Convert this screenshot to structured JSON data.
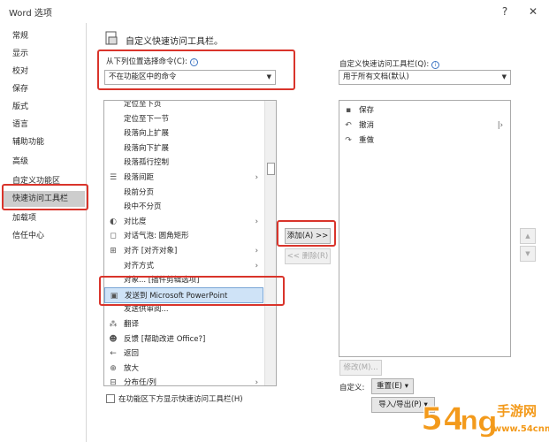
{
  "window": {
    "title": "Word 选项",
    "help": "?",
    "close": "✕"
  },
  "sidebar": {
    "items": [
      {
        "label": "常规"
      },
      {
        "label": "显示"
      },
      {
        "label": "校对"
      },
      {
        "label": "保存"
      },
      {
        "label": "版式"
      },
      {
        "label": "语言"
      },
      {
        "label": "辅助功能"
      },
      {
        "label": "高级"
      },
      {
        "label": "自定义功能区"
      },
      {
        "label": "快速访问工具栏"
      },
      {
        "label": "加载项"
      },
      {
        "label": "信任中心"
      }
    ],
    "active_index": 9
  },
  "header": {
    "title": "自定义快速访问工具栏。"
  },
  "choose_commands": {
    "label": "从下列位置选择命令(C):",
    "info_icon": "info-icon",
    "value": "不在功能区中的命令"
  },
  "customize_qat": {
    "label": "自定义快速访问工具栏(Q):",
    "info_icon": "info-icon",
    "value": "用于所有文档(默认)"
  },
  "commands": [
    {
      "label": "定位至下页",
      "icon": ""
    },
    {
      "label": "定位至下一节",
      "icon": ""
    },
    {
      "label": "段落向上扩展",
      "icon": ""
    },
    {
      "label": "段落向下扩展",
      "icon": ""
    },
    {
      "label": "段落孤行控制",
      "icon": ""
    },
    {
      "label": "段落间距",
      "icon": "paragraph-spacing-icon",
      "sub": "›"
    },
    {
      "label": "段前分页",
      "icon": ""
    },
    {
      "label": "段中不分页",
      "icon": ""
    },
    {
      "label": "对比度",
      "icon": "contrast-icon",
      "sub": "›"
    },
    {
      "label": "对话气泡: 圆角矩形",
      "icon": "speech-bubble-icon"
    },
    {
      "label": "对齐 [对齐对象]",
      "icon": "align-icon",
      "sub": "›"
    },
    {
      "label": "对齐方式",
      "icon": "",
      "sub": "›"
    },
    {
      "label": "对象... [插件剪辑选项]",
      "icon": ""
    },
    {
      "label": "发送到 Microsoft PowerPoint",
      "icon": "powerpoint-icon",
      "selected": true
    },
    {
      "label": "发送供审阅...",
      "icon": ""
    },
    {
      "label": "翻译",
      "icon": "translate-icon"
    },
    {
      "label": "反馈 [帮助改进 Office?]",
      "icon": "feedback-icon"
    },
    {
      "label": "返回",
      "icon": "back-arrow-icon"
    },
    {
      "label": "放大",
      "icon": "zoom-in-icon"
    },
    {
      "label": "分布任/列",
      "icon": "distribute-icon",
      "sub": "›"
    }
  ],
  "qat_items": [
    {
      "label": "保存",
      "icon": "save-icon"
    },
    {
      "label": "撤消",
      "icon": "undo-icon",
      "sub": "|›"
    },
    {
      "label": "重做",
      "icon": "redo-icon"
    }
  ],
  "buttons": {
    "add": "添加(A) >>",
    "remove": "<< 删除(R)",
    "modify": "修改(M)...",
    "reset": "重置(E) ▾",
    "import_export": "导入/导出(P) ▾",
    "move_up": "▲",
    "move_down": "▼"
  },
  "customize_label": "自定义:",
  "show_below_ribbon": "在功能区下方显示快速访问工具栏(H)",
  "watermark": {
    "text": "54",
    "text2": "手游网",
    "url": "www.54cnm.cn"
  },
  "colors": {
    "highlight_red": "#d9342b",
    "active_nav": "#cdcdcd",
    "watermark_orange": "#f39a1b"
  }
}
